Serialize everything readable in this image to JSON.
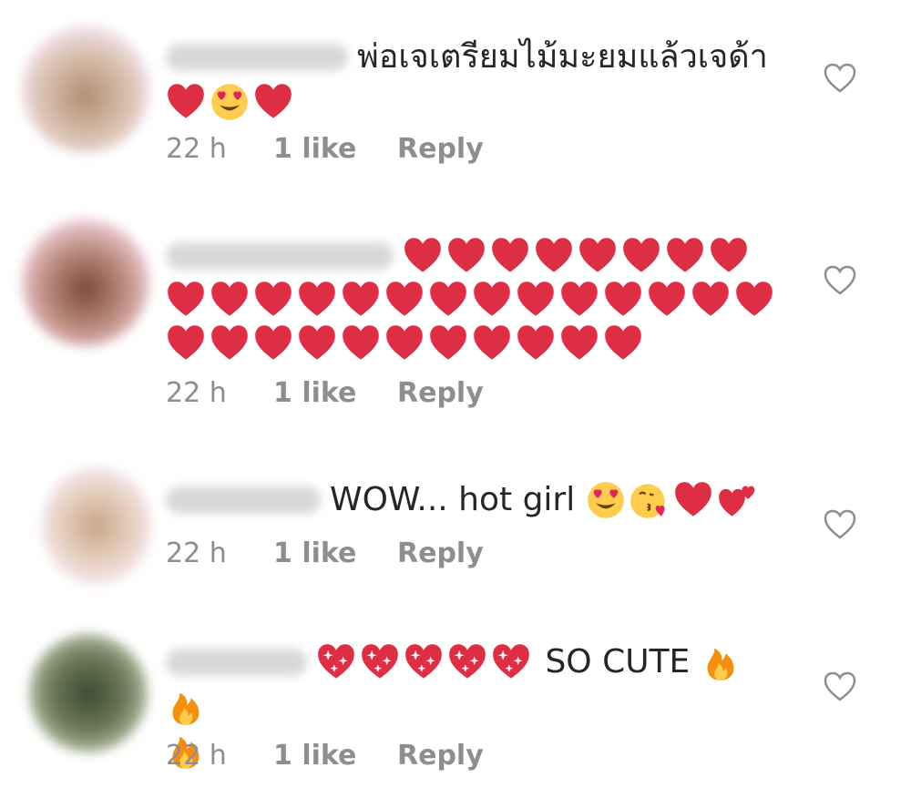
{
  "colors": {
    "text": "#262626",
    "meta": "#8e8e8e",
    "heart": "#dd2e44",
    "face": "#ffcc4d",
    "fire": "#f4900c"
  },
  "comments": [
    {
      "text": "พ่อเจเตรียมไม้มะยมแล้วเจด้า",
      "emojis_after": [
        "red-heart",
        "heart-eyes-face",
        "red-heart"
      ],
      "time": "22 h",
      "likes": "1 like",
      "reply": "Reply"
    },
    {
      "text": "",
      "emojis": "33 × red-heart",
      "time": "22 h",
      "likes": "1 like",
      "reply": "Reply"
    },
    {
      "text": "WOW... hot girl",
      "emojis_after": [
        "heart-eyes-face",
        "kissing-heart-face",
        "red-heart",
        "two-hearts"
      ],
      "time": "22 h",
      "likes": "1 like",
      "reply": "Reply"
    },
    {
      "emojis_before": [
        "sparkling-heart",
        "sparkling-heart",
        "sparkling-heart",
        "sparkling-heart",
        "sparkling-heart"
      ],
      "text": "SO CUTE",
      "emojis_after": [
        "fire",
        "fire",
        "fire"
      ],
      "time": "22 h",
      "likes": "1 like",
      "reply": "Reply"
    }
  ]
}
